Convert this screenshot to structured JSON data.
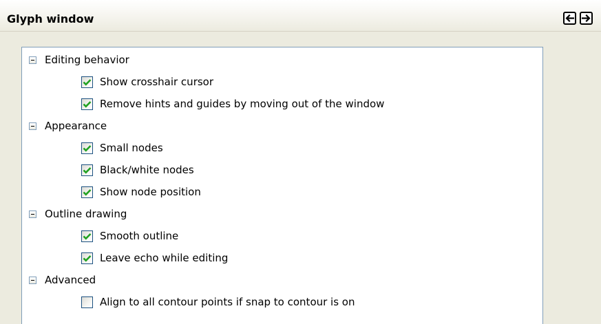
{
  "header": {
    "title": "Glyph window",
    "back_icon": "arrow-left-icon",
    "forward_icon": "arrow-right-icon"
  },
  "colors": {
    "check_mark": "#21a121",
    "tree_border": "#7f9db9",
    "panel_background": "#ecebdf"
  },
  "tree": {
    "groups": [
      {
        "label": "Editing behavior",
        "expanded": true,
        "items": [
          {
            "label": "Show crosshair cursor",
            "checked": true
          },
          {
            "label": "Remove hints and guides by moving out of the window",
            "checked": true
          }
        ]
      },
      {
        "label": "Appearance",
        "expanded": true,
        "items": [
          {
            "label": "Small nodes",
            "checked": true
          },
          {
            "label": "Black/white nodes",
            "checked": true
          },
          {
            "label": "Show node position",
            "checked": true
          }
        ]
      },
      {
        "label": "Outline drawing",
        "expanded": true,
        "items": [
          {
            "label": "Smooth outline",
            "checked": true
          },
          {
            "label": "Leave echo while editing",
            "checked": true
          }
        ]
      },
      {
        "label": "Advanced",
        "expanded": true,
        "items": [
          {
            "label": "Align to all contour points if snap to contour is on",
            "checked": false
          }
        ]
      }
    ]
  }
}
